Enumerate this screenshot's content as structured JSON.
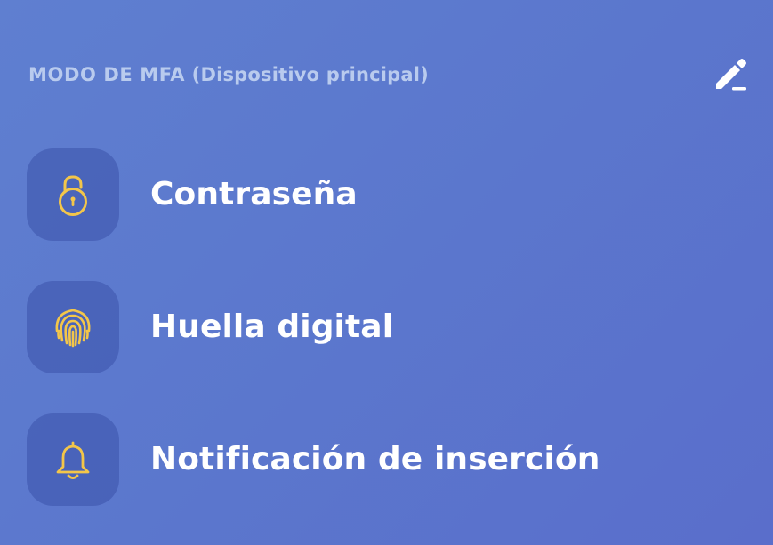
{
  "header": {
    "mode_label": "MODO DE MFA",
    "device_label": "(Dispositivo principal)",
    "edit_icon": "pencil-edit-icon"
  },
  "colors": {
    "background": "#5b77cd",
    "icon_tile": "#4a64b8",
    "accent_yellow": "#f3c64a",
    "header_text": "#b9cbee",
    "label_text": "#ffffff"
  },
  "methods": [
    {
      "label": "Contraseña",
      "icon": "padlock-icon"
    },
    {
      "label": "Huella digital",
      "icon": "fingerprint-icon"
    },
    {
      "label": "Notificación de inserción",
      "icon": "bell-icon"
    }
  ]
}
